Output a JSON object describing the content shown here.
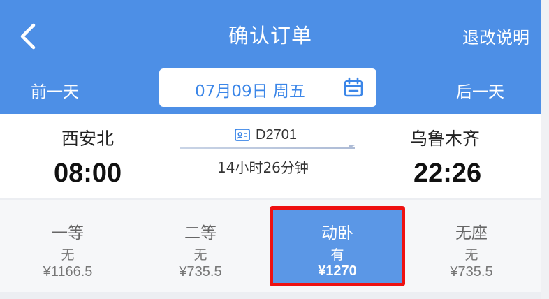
{
  "header": {
    "title": "确认订单",
    "refund_link": "退改说明",
    "prev_day": "前一天",
    "next_day": "后一天",
    "date": "07月09日 周五",
    "back_icon": "chevron-left-icon",
    "calendar_icon": "calendar-icon"
  },
  "train": {
    "from_station": "西安北",
    "from_time": "08:00",
    "to_station": "乌鲁木齐",
    "to_time": "22:26",
    "train_no": "D2701",
    "duration": "14小时26分钟",
    "id_icon": "id-card-icon"
  },
  "seats": [
    {
      "name": "一等",
      "availability": "无",
      "price": "¥1166.5",
      "selected": false
    },
    {
      "name": "二等",
      "availability": "无",
      "price": "¥735.5",
      "selected": false
    },
    {
      "name": "动卧",
      "availability": "有",
      "price": "¥1270",
      "selected": true
    },
    {
      "name": "无座",
      "availability": "无",
      "price": "¥735.5",
      "selected": false
    }
  ],
  "colors": {
    "header_bg": "#4d8fe6",
    "accent_text": "#3b86e8",
    "selected_bg": "#5b97e6",
    "highlight_border": "#ee1111"
  }
}
